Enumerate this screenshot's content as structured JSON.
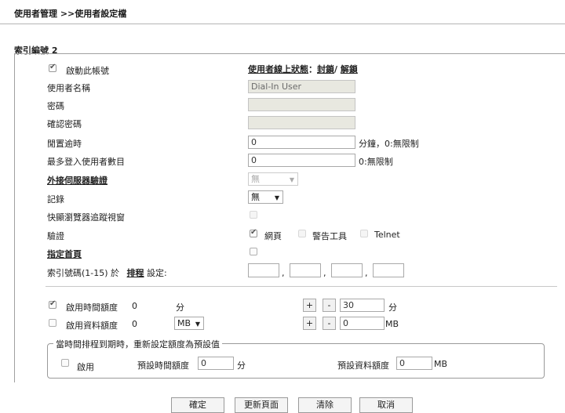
{
  "breadcrumb": "使用者管理 >>使用者設定檔",
  "index_title": "索引編號 2",
  "enable_account": {
    "label": "啟動此帳號",
    "checked": true
  },
  "online_status": {
    "prefix": "使用者線上狀態",
    "colon": "：",
    "block": "封鎖",
    "slash": "/ ",
    "unblock": "解鎖"
  },
  "username": {
    "label": "使用者名稱",
    "value": "Dial-In User"
  },
  "password": {
    "label": "密碼",
    "value": ""
  },
  "confirm_password": {
    "label": "確認密碼",
    "value": ""
  },
  "idle_timeout": {
    "label": "閒置逾時",
    "value": "0",
    "unit": "分鐘，0:無限制"
  },
  "max_login": {
    "label": "最多登入使用者數目",
    "value": "0",
    "unit": "0:無限制"
  },
  "external_auth": {
    "label": "外接伺服器驗證",
    "value": "無"
  },
  "log": {
    "label": "記錄",
    "value": "無"
  },
  "popup_tracking": {
    "label": "快顯瀏覽器追蹤視窗",
    "checked": false
  },
  "auth": {
    "label": "驗證",
    "web": "網頁",
    "web_checked": true,
    "alert": "警告工具",
    "alert_checked": false,
    "telnet": "Telnet",
    "telnet_checked": false
  },
  "home_page": {
    "label": "指定首頁",
    "checked": false
  },
  "schedule": {
    "label_a": "索引號碼(1-15) 於",
    "label_link": "排程",
    "label_b": "設定:",
    "values": [
      "",
      "",
      "",
      ""
    ],
    "comma": ","
  },
  "time_quota": {
    "label": "啟用時間額度",
    "checked": true,
    "value": "0",
    "unit": "分",
    "plus": "+",
    "minus": "-",
    "adjust": "30",
    "adjust_unit": "分"
  },
  "data_quota": {
    "label": "啟用資料額度",
    "checked": false,
    "value": "0",
    "unit_sel": "MB",
    "plus": "+",
    "minus": "-",
    "adjust": "0",
    "adjust_unit": "MB"
  },
  "reset": {
    "legend": "當時間排程到期時，重新設定額度為預設值",
    "enable": "啟用",
    "checked": false,
    "time_label": "預設時間額度",
    "time_value": "0",
    "time_unit": "分",
    "data_label": "預設資料額度",
    "data_value": "0",
    "data_unit": "MB"
  },
  "buttons": {
    "ok": "確定",
    "refresh": "更新頁面",
    "clear": "清除",
    "cancel": "取消"
  }
}
